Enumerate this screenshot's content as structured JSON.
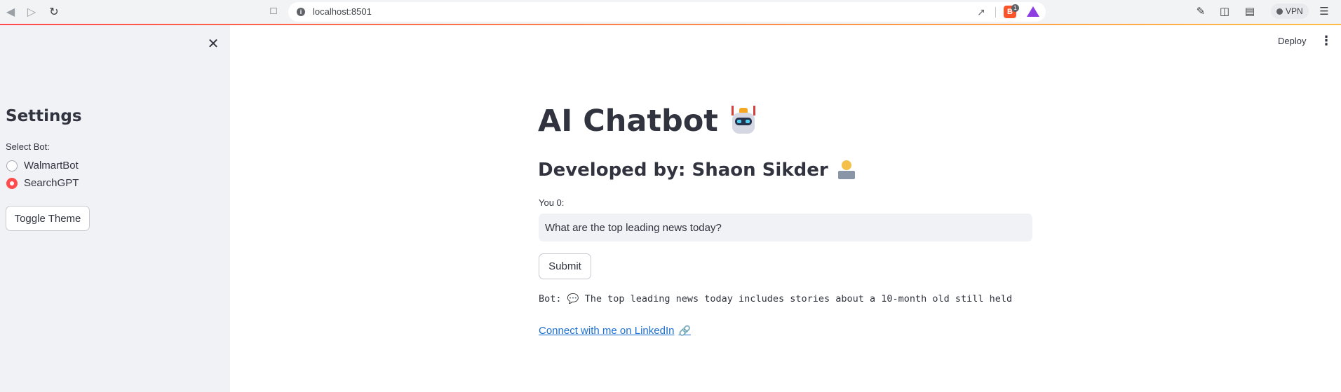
{
  "browser": {
    "url": "localhost:8501",
    "info_icon": "i",
    "vpn_label": "VPN",
    "brave_badge": "1"
  },
  "sidebar": {
    "title": "Settings",
    "select_label": "Select Bot:",
    "options": [
      "WalmartBot",
      "SearchGPT"
    ],
    "selected": "SearchGPT",
    "toggle_label": "Toggle Theme"
  },
  "header": {
    "deploy_label": "Deploy"
  },
  "main": {
    "title": "AI Chatbot",
    "subtitle": "Developed by: Shaon Sikder",
    "input_label": "You 0:",
    "input_value": "What are the top leading news today?",
    "submit_label": "Submit",
    "bot_prefix": "Bot:",
    "bot_response": "The top leading news today includes stories about a 10-month old still held",
    "link_text": "Connect with me on LinkedIn"
  },
  "colors": {
    "accent": "#ff4b4b",
    "sidebar_bg": "#f0f2f6",
    "link": "#1c6fd1"
  }
}
